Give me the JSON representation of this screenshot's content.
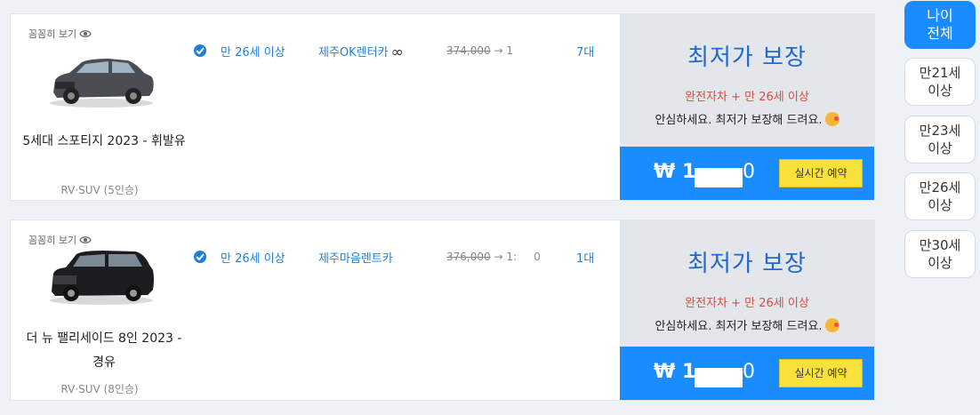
{
  "filters": {
    "items": [
      {
        "line1": "나이",
        "line2": "전체",
        "active": true
      },
      {
        "line1": "만21세",
        "line2": "이상",
        "active": false
      },
      {
        "line1": "만23세",
        "line2": "이상",
        "active": false
      },
      {
        "line1": "만26세",
        "line2": "이상",
        "active": false
      },
      {
        "line1": "만30세",
        "line2": "이상",
        "active": false
      }
    ]
  },
  "cards": [
    {
      "peek_label": "꼼꼼히 보기",
      "car_name": "5세대 스포티지 2023 - 휘발유",
      "car_type": "RV·SUV (5인승)",
      "age_condition": "만 26세 이상",
      "company": "제주OK렌터카",
      "company_symbol": "∞",
      "price_old": "374,000",
      "price_arrow": "→",
      "price_new_partial": "1       ",
      "count": "7대",
      "guarantee_title": "최저가 보장",
      "guarantee_condition": "완전자차 + 만 26세 이상",
      "guarantee_message": "안심하세요. 최저가 보장해 드려요.",
      "currency_symbol": "₩",
      "total_prefix": "1",
      "total_suffix": "0",
      "reserve_label": "실시간 예약",
      "car_color": "#4a4d52"
    },
    {
      "peek_label": "꼼꼼히 보기",
      "car_name": "더 뉴 팰리세이드 8인 2023 - 경유",
      "car_type": "RV·SUV (8인승)",
      "age_condition": "만 26세 이상",
      "company": "제주마음렌트카",
      "company_symbol": "",
      "price_old": "376,000",
      "price_arrow": "→",
      "price_new_partial": "1:     0",
      "count": "1대",
      "guarantee_title": "최저가 보장",
      "guarantee_condition": "완전자차 + 만 26세 이상",
      "guarantee_message": "안심하세요. 최저가 보장해 드려요.",
      "currency_symbol": "₩",
      "total_prefix": "1",
      "total_suffix": "0",
      "reserve_label": "실시간 예약",
      "car_color": "#1c1d20"
    }
  ]
}
